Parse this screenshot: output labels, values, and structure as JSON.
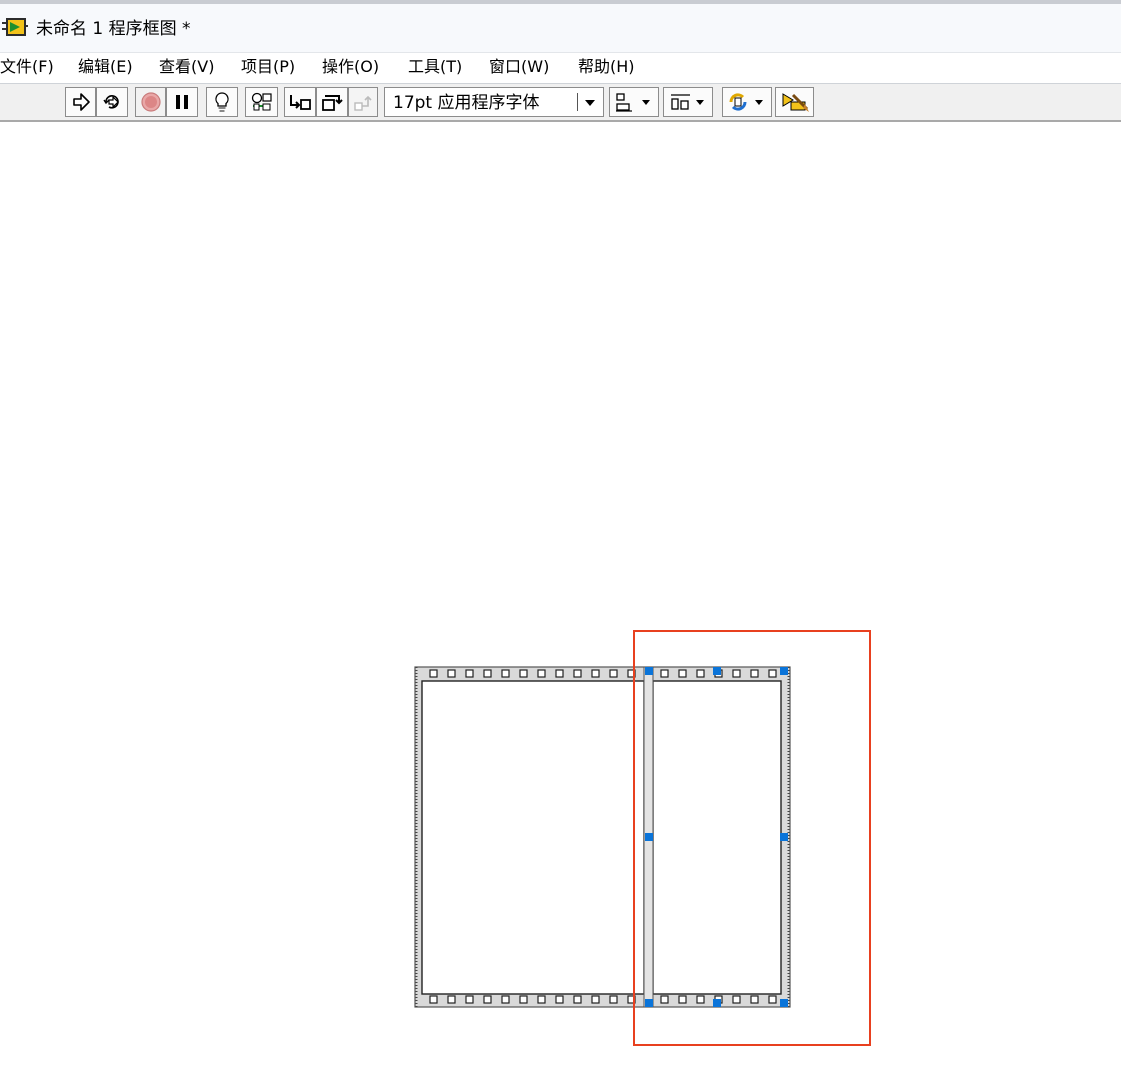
{
  "window": {
    "title": "未命名 1 程序框图 *",
    "icon": "labview-vi-icon"
  },
  "menubar": {
    "items": [
      {
        "label": "文件(F)",
        "name": "menu-file"
      },
      {
        "label": "编辑(E)",
        "name": "menu-edit"
      },
      {
        "label": "查看(V)",
        "name": "menu-view"
      },
      {
        "label": "项目(P)",
        "name": "menu-project"
      },
      {
        "label": "操作(O)",
        "name": "menu-operate"
      },
      {
        "label": "工具(T)",
        "name": "menu-tools"
      },
      {
        "label": "窗口(W)",
        "name": "menu-window"
      },
      {
        "label": "帮助(H)",
        "name": "menu-help"
      }
    ]
  },
  "toolbar": {
    "font_label": "17pt 应用程序字体",
    "buttons": [
      "run-icon",
      "run-continuously-icon",
      "abort-icon",
      "pause-icon",
      "highlight-execution-icon",
      "retain-wire-values-icon",
      "step-into-icon",
      "step-over-icon",
      "step-out-icon",
      "align-objects-icon",
      "distribute-objects-icon",
      "reorder-icon",
      "clean-up-diagram-icon"
    ]
  },
  "diagram": {
    "structure": "flat-sequence-structure",
    "frames": 2,
    "selected_frame": 2
  },
  "colors": {
    "selection_handle": "#0a74d9",
    "highlight_border": "#e8401f",
    "frame_border": "#555555"
  }
}
